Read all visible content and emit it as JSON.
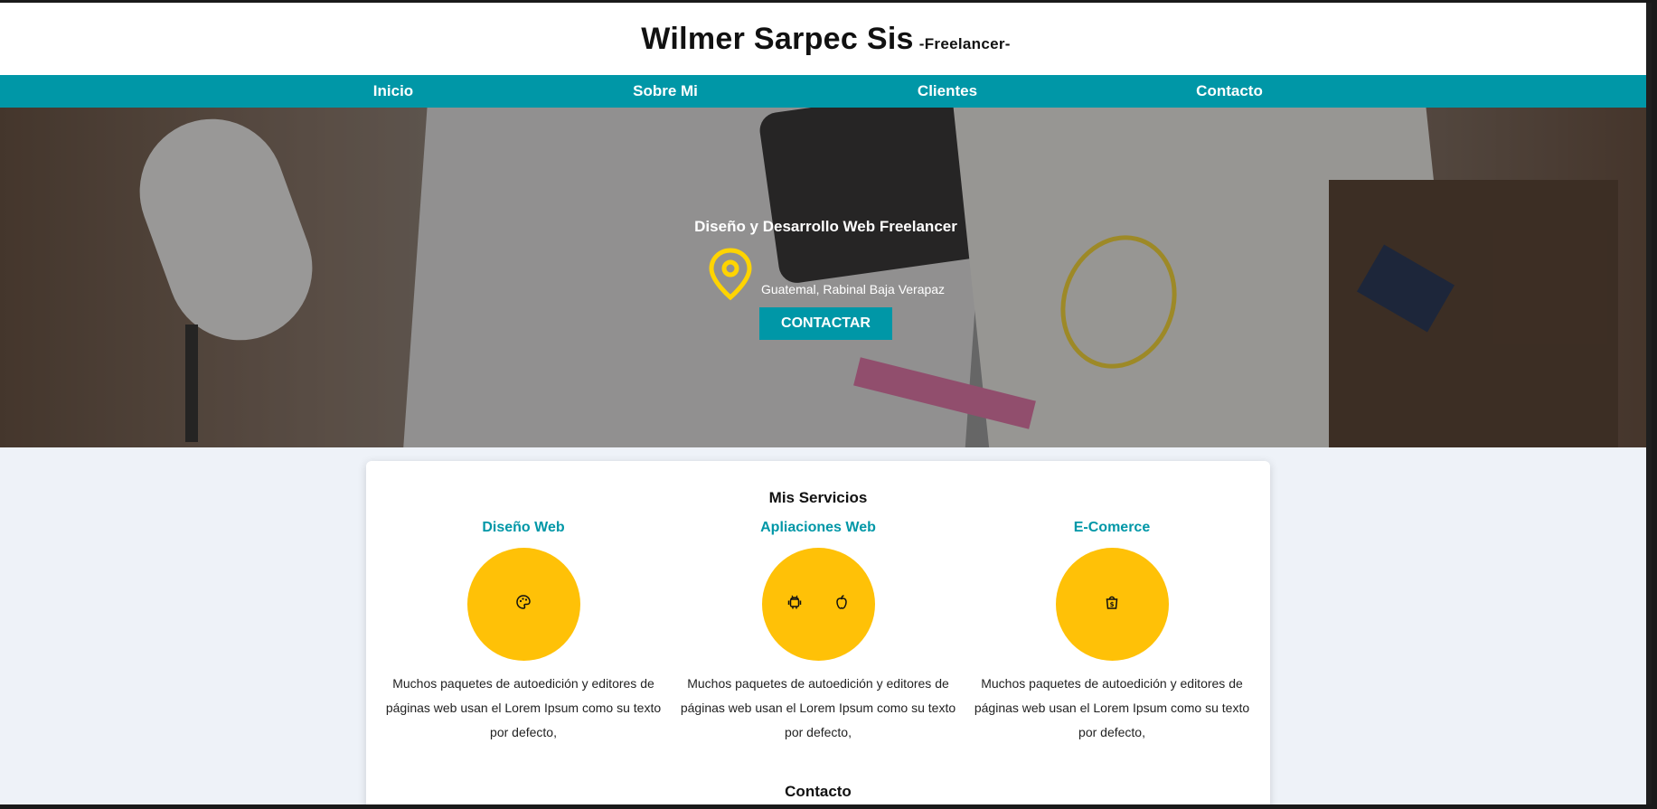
{
  "header": {
    "name": "Wilmer Sarpec Sis",
    "tagline": "-Freelancer-"
  },
  "nav": {
    "items": [
      {
        "label": "Inicio"
      },
      {
        "label": "Sobre Mi"
      },
      {
        "label": "Clientes"
      },
      {
        "label": "Contacto"
      }
    ]
  },
  "hero": {
    "title": "Diseño y Desarrollo Web Freelancer",
    "location": "Guatemal, Rabinal Baja Verapaz",
    "cta": "CONTACTAR"
  },
  "services": {
    "title": "Mis Servicios",
    "items": [
      {
        "title": "Diseño Web",
        "icons": [
          "palette-icon"
        ],
        "description": "Muchos paquetes de autoedición y editores de páginas web usan el Lorem Ipsum como su texto por defecto,"
      },
      {
        "title": "Apliaciones Web",
        "icons": [
          "android-icon",
          "apple-icon"
        ],
        "description": "Muchos paquetes de autoedición y editores de páginas web usan el Lorem Ipsum como su texto por defecto,"
      },
      {
        "title": "E-Comerce",
        "icons": [
          "shopping-bag-icon"
        ],
        "description": "Muchos paquetes de autoedición y editores de páginas web usan el Lorem Ipsum como su texto por defecto,"
      }
    ]
  },
  "contact": {
    "title": "Contacto"
  },
  "colors": {
    "accent": "#0097a7",
    "yellow": "#ffc107",
    "pin": "#ffd400"
  }
}
